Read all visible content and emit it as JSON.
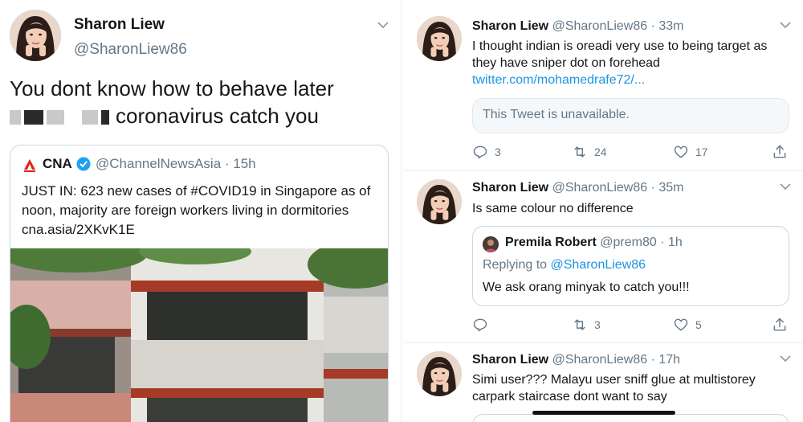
{
  "left_tweet": {
    "name": "Sharon Liew",
    "handle": "@SharonLiew86",
    "text_line1": "You dont know how to behave later",
    "text_line2": "coronavirus catch you",
    "quote": {
      "name": "CNA",
      "handle_time": "@ChannelNewsAsia · 15h",
      "text": "JUST IN: 623 new cases of #COVID19 in Singapore as of noon, majority are foreign workers living in dormitories cna.asia/2XKvK1E"
    }
  },
  "right_feed": {
    "tweets": [
      {
        "name": "Sharon Liew",
        "meta": "@SharonLiew86 · 33m",
        "text": "I thought indian is oreadi very use to being target as they have sniper dot on forehead",
        "link": "twitter.com/mohamedrafe72/...",
        "unavailable": "This Tweet is unavailable.",
        "replies": "3",
        "retweets": "24",
        "likes": "17"
      },
      {
        "name": "Sharon Liew",
        "meta": "@SharonLiew86 · 35m",
        "text": "Is same colour no difference",
        "quote": {
          "name": "Premila Robert",
          "meta": "@prem80 · 1h",
          "replying_prefix": "Replying to",
          "replying_handle": "@SharonLiew86",
          "text": "We ask orang minyak to catch you!!!"
        },
        "replies": "",
        "retweets": "3",
        "likes": "5"
      },
      {
        "name": "Sharon Liew",
        "meta": "@SharonLiew86 · 17h",
        "text": "Simi user??? Malayu user sniff glue at multistorey carpark staircase dont want to say"
      }
    ]
  },
  "colors": {
    "text": "#14171a",
    "secondary": "#657786",
    "link": "#1b95e0",
    "border": "#e6ecf0",
    "verified": "#1da1f2",
    "cna_red": "#e2231a"
  }
}
